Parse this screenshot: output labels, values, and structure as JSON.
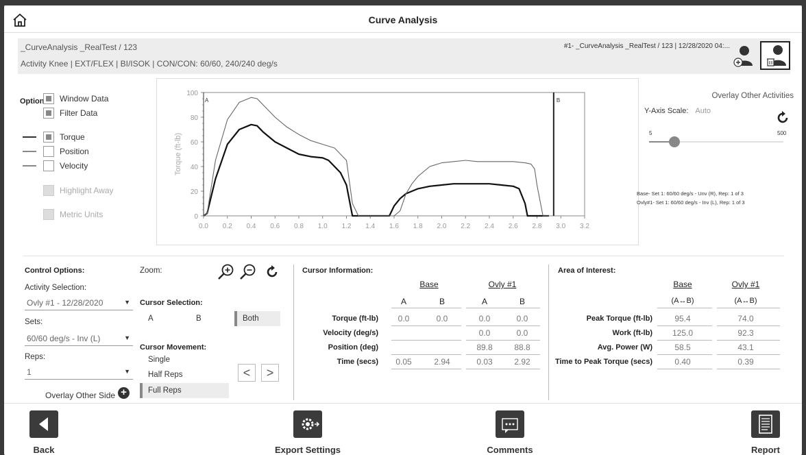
{
  "header": {
    "title": "Curve Analysis"
  },
  "info": {
    "test_name": "_CurveAnalysis _RealTest / 123",
    "activity": "Activity  Knee | EXT/FLEX | BI/ISOK | CON/CON: 60/60, 240/240 deg/s",
    "overlay_info": "#1- _CurveAnalysis _RealTest / 123 | 12/28/2020 04:...",
    "overlay_label": "Overlay Other Activities"
  },
  "options": {
    "title": "Options:",
    "window_data": "Window Data",
    "filter_data": "Filter Data",
    "torque": "Torque",
    "position": "Position",
    "velocity": "Velocity",
    "highlight_away": "Highlight Away",
    "metric_units": "Metric Units"
  },
  "chart_data": {
    "type": "line",
    "ylabel": "Torque (ft-lb)",
    "xlim": [
      0.0,
      3.2
    ],
    "ylim": [
      0,
      100
    ],
    "xticks": [
      "0.0",
      "0.2",
      "0.4",
      "0.6",
      "0.8",
      "1.0",
      "1.2",
      "1.4",
      "1.6",
      "1.8",
      "2.0",
      "2.2",
      "2.4",
      "2.6",
      "2.8",
      "3.0",
      "3.2"
    ],
    "yticks": [
      "0",
      "20",
      "40",
      "60",
      "80",
      "100"
    ],
    "cursor_a_label": "A",
    "cursor_b_label": "B",
    "cursor_a_x": 0.0,
    "cursor_b_x": 2.94,
    "series": [
      {
        "name": "Base",
        "style": "thick",
        "x": [
          0.0,
          0.03,
          0.1,
          0.2,
          0.3,
          0.4,
          0.45,
          0.5,
          0.6,
          0.7,
          0.8,
          0.9,
          1.0,
          1.05,
          1.1,
          1.15,
          1.2,
          1.23,
          1.25,
          1.3,
          1.5,
          1.56,
          1.6,
          1.65,
          1.7,
          1.8,
          1.9,
          2.0,
          2.1,
          2.2,
          2.3,
          2.4,
          2.5,
          2.6,
          2.65,
          2.7,
          2.72,
          2.8,
          2.9
        ],
        "y": [
          0,
          2,
          30,
          58,
          70,
          74,
          73,
          68,
          60,
          55,
          50,
          48,
          47,
          45,
          40,
          35,
          25,
          10,
          0,
          0,
          0,
          0,
          8,
          14,
          18,
          22,
          24,
          25,
          26,
          26,
          26,
          26,
          25,
          24,
          22,
          10,
          0,
          0,
          0
        ]
      },
      {
        "name": "Ovly #1",
        "style": "thin",
        "x": [
          0.0,
          0.03,
          0.1,
          0.2,
          0.3,
          0.4,
          0.45,
          0.5,
          0.6,
          0.7,
          0.8,
          0.9,
          1.0,
          1.1,
          1.15,
          1.2,
          1.25,
          1.3,
          1.5,
          1.6,
          1.65,
          1.7,
          1.75,
          1.8,
          1.9,
          2.0,
          2.1,
          2.2,
          2.3,
          2.4,
          2.5,
          2.6,
          2.7,
          2.75,
          2.78,
          2.8,
          2.85,
          2.9
        ],
        "y": [
          0,
          2,
          45,
          78,
          92,
          96,
          95,
          90,
          80,
          72,
          66,
          61,
          58,
          55,
          50,
          45,
          10,
          0,
          0,
          0,
          4,
          18,
          26,
          32,
          40,
          43,
          44,
          45,
          44,
          44,
          44,
          44,
          43,
          42,
          38,
          25,
          0,
          0
        ]
      }
    ]
  },
  "yaxis": {
    "label": "Y-Axis Scale:",
    "value": "Auto",
    "min": "5",
    "max": "500",
    "slider_fraction": 0.19
  },
  "legend": {
    "base": "Base- Set 1: 60/60 deg/s - Unv (R), Rep: 1 of 3",
    "ovly": "Ovly#1- Set 1: 60/60 deg/s - Inv (L), Rep: 1 of 3"
  },
  "control": {
    "title": "Control Options:",
    "activity_label": "Activity Selection:",
    "activity_value": "Ovly #1 - 12/28/2020",
    "sets_label": "Sets:",
    "sets_value": "60/60 deg/s - Inv (L)",
    "reps_label": "Reps:",
    "reps_value": "1",
    "overlay_side": "Overlay Other Side"
  },
  "zoom": {
    "label": "Zoom:",
    "cursor_selection": "Cursor Selection:",
    "cursor_a": "A",
    "cursor_b": "B",
    "cursor_both": "Both",
    "cursor_movement": "Cursor Movement:",
    "single": "Single",
    "half_reps": "Half Reps",
    "full_reps": "Full Reps",
    "prev": "<",
    "next": ">"
  },
  "cursor_info": {
    "title": "Cursor Information:",
    "base": "Base",
    "ovly": "Ovly #1",
    "a": "A",
    "b": "B",
    "rows": [
      {
        "label": "Torque (ft-lb)",
        "vals": [
          "0.0",
          "0.0",
          "0.0",
          "0.0"
        ]
      },
      {
        "label": "Velocity (deg/s)",
        "vals": [
          "",
          "",
          "0.0",
          "0.0"
        ]
      },
      {
        "label": "Position (deg)",
        "vals": [
          "",
          "",
          "89.8",
          "88.8"
        ]
      },
      {
        "label": "Time (secs)",
        "vals": [
          "0.05",
          "2.94",
          "0.03",
          "2.92"
        ]
      }
    ]
  },
  "aoi": {
    "title": "Area of Interest:",
    "base": "Base",
    "ovly": "Ovly #1",
    "sub_base": "(A↔B)",
    "sub_ovly": "(A↔B)",
    "rows": [
      {
        "label": "Peak Torque (ft-lb)",
        "vals": [
          "95.4",
          "74.0"
        ]
      },
      {
        "label": "Work (ft-lb)",
        "vals": [
          "125.0",
          "92.3"
        ]
      },
      {
        "label": "Avg. Power (W)",
        "vals": [
          "58.5",
          "43.1"
        ]
      },
      {
        "label": "Time to Peak Torque (secs)",
        "vals": [
          "0.40",
          "0.39"
        ]
      }
    ]
  },
  "footer": {
    "back": "Back",
    "export": "Export Settings",
    "comments": "Comments",
    "report": "Report"
  }
}
